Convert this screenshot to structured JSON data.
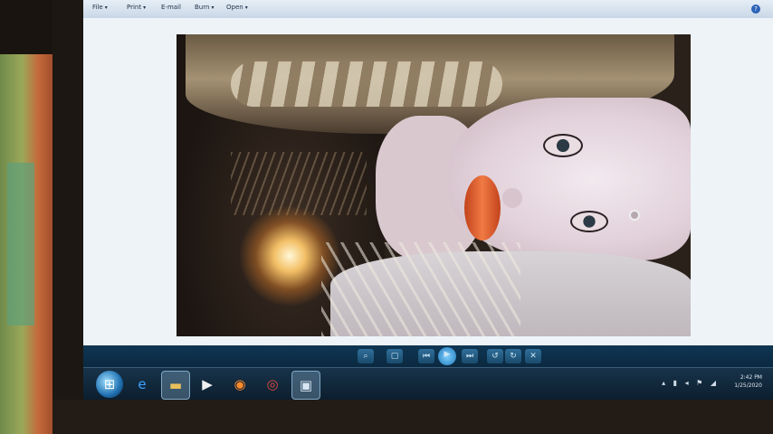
{
  "menubar": {
    "items": [
      {
        "label": "File",
        "arrow": "▾"
      },
      {
        "label": "Print",
        "arrow": "▾"
      },
      {
        "label": "E-mail",
        "arrow": ""
      },
      {
        "label": "Burn",
        "arrow": "▾"
      },
      {
        "label": "Open",
        "arrow": "▾"
      }
    ],
    "help_glyph": "?"
  },
  "controls": {
    "left_label_1": "",
    "left_label_2": "",
    "buttons": [
      {
        "name": "zoom-icon",
        "glyph": "⌕"
      },
      {
        "name": "actual-size-icon",
        "glyph": "▢"
      },
      {
        "name": "previous-icon",
        "glyph": "⏮"
      },
      {
        "name": "slideshow-play-icon",
        "glyph": "▶"
      },
      {
        "name": "next-icon",
        "glyph": "⏭"
      },
      {
        "name": "rotate-left-icon",
        "glyph": "↺"
      },
      {
        "name": "rotate-right-icon",
        "glyph": "↻"
      },
      {
        "name": "delete-icon",
        "glyph": "✕"
      }
    ]
  },
  "taskbar": {
    "apps": [
      {
        "name": "start-button",
        "glyph": "⊞"
      },
      {
        "name": "internet-explorer-icon",
        "glyph": "e"
      },
      {
        "name": "file-explorer-icon",
        "glyph": "▬"
      },
      {
        "name": "media-player-icon",
        "glyph": "▶"
      },
      {
        "name": "firefox-icon",
        "glyph": "◉"
      },
      {
        "name": "chrome-icon",
        "glyph": "◎"
      },
      {
        "name": "photo-viewer-icon",
        "glyph": "▣"
      }
    ],
    "tray": "▴ ▮ ◂ ⚑ ◢",
    "clock_time": "2:42 PM",
    "clock_date": "1/25/2020"
  },
  "colors": {
    "menubar": "#dbe6f1",
    "taskbar": "#17334a",
    "controlbar": "#0f3654"
  }
}
